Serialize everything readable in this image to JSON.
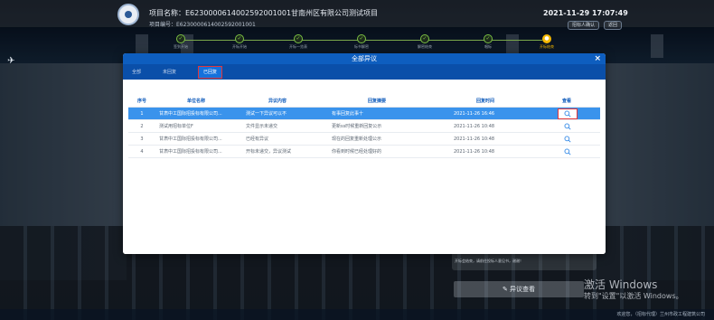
{
  "header": {
    "project_name": "项目名称：E6230000614002592001001甘南州区有限公司测试项目",
    "project_no": "项目编号：E6230000614002592001001",
    "datetime": "2021-11-29  17:07:49",
    "btn_1": "招标人确认",
    "btn_2": "返回"
  },
  "steps": [
    {
      "label": "签到开始",
      "state": "done"
    },
    {
      "label": "开标开始",
      "state": "done"
    },
    {
      "label": "开标一览表",
      "state": "done"
    },
    {
      "label": "标书解密",
      "state": "done"
    },
    {
      "label": "解密结束",
      "state": "done"
    },
    {
      "label": "唱标",
      "state": "done"
    },
    {
      "label": "开标结束",
      "state": "current"
    }
  ],
  "dialog": {
    "title": "全部异议",
    "close": "×",
    "tabs": [
      "全部",
      "未回复",
      "已回复"
    ],
    "active_tab": 2,
    "columns": [
      "序号",
      "单位名称",
      "异议内容",
      "回复摘要",
      "回复时间",
      "查看"
    ],
    "rows": [
      {
        "no": "1",
        "unit": "甘肃中工国际招投标有限公司...",
        "content": "测试一下异议可以不",
        "reply": "有事回复此事十",
        "time": "2021-11-26 16:46"
      },
      {
        "no": "2",
        "unit": "测试用招标单位F",
        "content": "文件显示未递交",
        "reply": "更新ss时候重新回复公示",
        "time": "2021-11-26 10:48"
      },
      {
        "no": "3",
        "unit": "甘肃中工国际招投标有限公司...",
        "content": "已经有异议",
        "reply": "现在的回复重新处理公示",
        "time": "2021-11-26 10:48"
      },
      {
        "no": "4",
        "unit": "甘肃中工国际招投标有限公司...",
        "content": "开标未递交，异议测试",
        "reply": "你看到时候已经处理好的",
        "time": "2021-11-26 10:48"
      }
    ]
  },
  "side_panel": {
    "tip": "开标会结束，请前往投标人意见书，谢谢！"
  },
  "objection_button": "异议查看",
  "watermark": {
    "line1": "激活 Windows",
    "line2": "转到\"设置\"以激活 Windows。"
  },
  "footer": "欢迎您，（招标代理）兰州市政工程建筑公司",
  "colors": {
    "dialog_header": "#0e5ebf",
    "tab_bar": "#0a4fa9",
    "selected_row": "#3a93ec",
    "highlight_border": "#e0363a",
    "step_done": "#7bc043",
    "step_current": "#f5b800"
  },
  "icons": {
    "view": "search-icon",
    "logo": "emblem-logo",
    "sidebar": "bird-icon"
  }
}
